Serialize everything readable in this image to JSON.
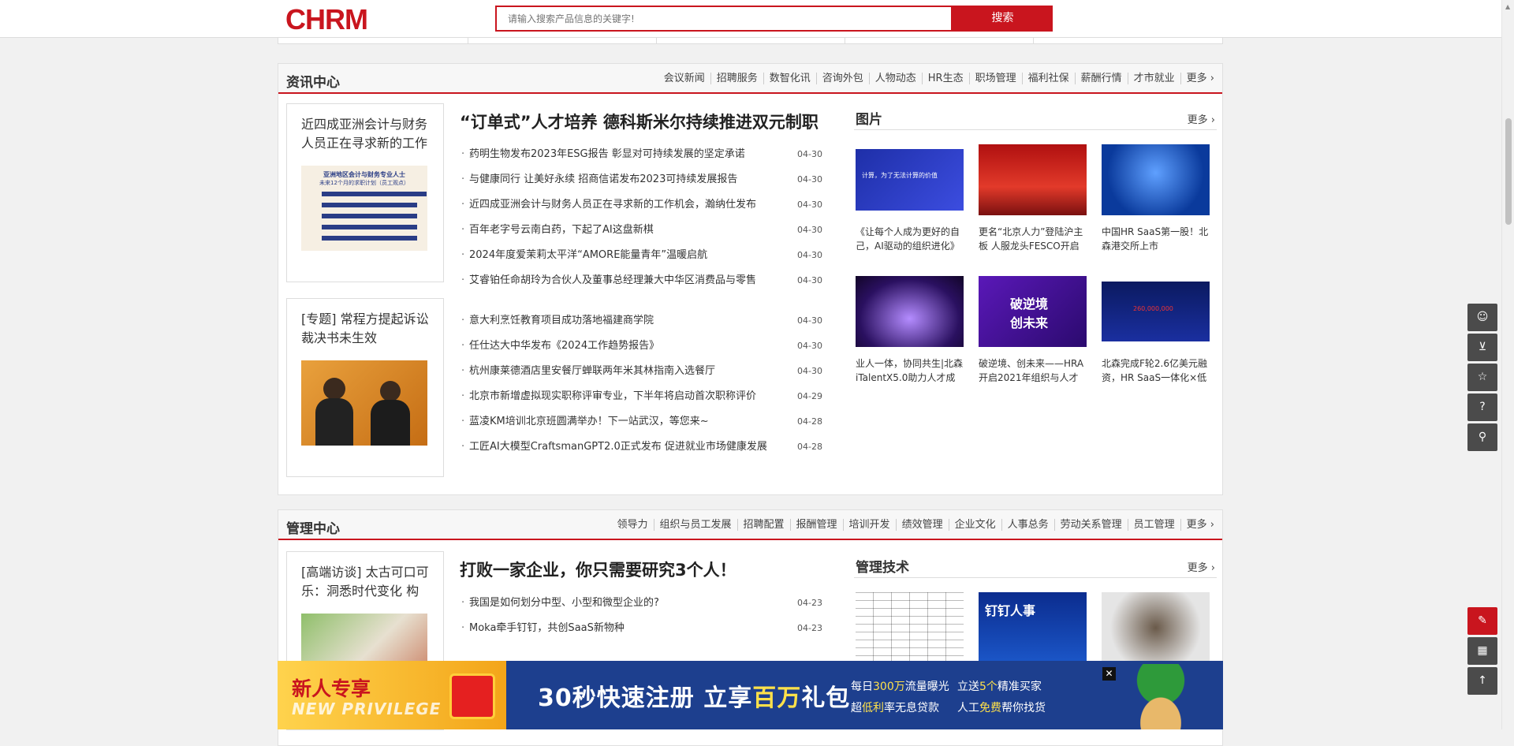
{
  "header": {
    "logo": "CHRM",
    "search_placeholder": "请输入搜索产品信息的关键字!",
    "search_button": "搜索"
  },
  "news_center": {
    "title": "资讯中心",
    "nav": [
      "会议新闻",
      "招聘服务",
      "数智化讯",
      "咨询外包",
      "人物动态",
      "HR生态",
      "职场管理",
      "福利社保",
      "薪酬行情",
      "才市就业",
      "更多"
    ],
    "feature1": {
      "title": "近四成亚洲会计与财务人员正在寻求新的工作",
      "chart_title": "亚洲地区会计与财务专业人士",
      "chart_subtitle": "未来12个月的求职计划（员工观点）"
    },
    "feature2": {
      "title": "[专题] 常程方提起诉讼裁决书未生效"
    },
    "headline": "“订单式”人才培养 德科斯米尔持续推进双元制职",
    "news": [
      {
        "title": "药明生物发布2023年ESG报告 彰显对可持续发展的坚定承诺",
        "date": "04-30"
      },
      {
        "title": "与健康同行 让美好永续 招商信诺发布2023可持续发展报告",
        "date": "04-30"
      },
      {
        "title": "近四成亚洲会计与财务人员正在寻求新的工作机会，瀚纳仕发布",
        "date": "04-30"
      },
      {
        "title": "百年老字号云南白药，下起了AI这盘新棋",
        "date": "04-30"
      },
      {
        "title": "2024年度爱茉莉太平洋“AMORE能量青年”温暖启航",
        "date": "04-30"
      },
      {
        "title": "艾睿铂任命胡玲为合伙人及董事总经理兼大中华区消费品与零售",
        "date": "04-30"
      }
    ],
    "news2": [
      {
        "title": "意大利烹饪教育项目成功落地福建商学院",
        "date": "04-30"
      },
      {
        "title": "任仕达大中华发布《2024工作趋势报告》",
        "date": "04-30"
      },
      {
        "title": "杭州康莱德酒店里安餐厅蝉联两年米其林指南入选餐厅",
        "date": "04-30"
      },
      {
        "title": "北京市新增虚拟现实职称评审专业，下半年将启动首次职称评价",
        "date": "04-29"
      },
      {
        "title": "蓝凌KM培训北京班圆满举办！下一站武汉，等您来~",
        "date": "04-28"
      },
      {
        "title": "工匠AI大模型CraftsmanGPT2.0正式发布 促进就业市场健康发展",
        "date": "04-28"
      }
    ],
    "photos": {
      "title": "图片",
      "more": "更多",
      "items": [
        {
          "caption": "《让每个人成为更好的自己，AI驱动的组织进化》",
          "img_text": "计算，为了无法计算的价值"
        },
        {
          "caption": "更名“北京人力”登陆沪主板 人服龙头FESCO开启",
          "img_text": ""
        },
        {
          "caption": "中国HR SaaS第一股！北森港交所上市",
          "img_text": ""
        },
        {
          "caption": "业人一体，协同共生|北森iTalentX5.0助力人才成功",
          "img_text": ""
        },
        {
          "caption": "破逆境、创未来——HRA开启2021年组织与人才发",
          "img_text": "破逆境 创未来"
        },
        {
          "caption": "北森完成F轮2.6亿美元融资，HR SaaS一体化×低代",
          "img_text": "260,000,000"
        }
      ]
    }
  },
  "mgmt_center": {
    "title": "管理中心",
    "nav": [
      "领导力",
      "组织与员工发展",
      "招聘配置",
      "报酬管理",
      "培训开发",
      "绩效管理",
      "企业文化",
      "人事总务",
      "劳动关系管理",
      "员工管理",
      "更多"
    ],
    "feature1": {
      "title": "[高端访谈] 太古可口可乐：洞悉时代变化 构"
    },
    "headline": "打败一家企业，你只需要研究3个人！",
    "news": [
      {
        "title": "我国是如何划分中型、小型和微型企业的?",
        "date": "04-23"
      },
      {
        "title": "Moka牵手钉钉，共创SaaS新物种",
        "date": "04-23"
      }
    ],
    "tech": {
      "title": "管理技术",
      "more": "更多",
      "img2_text": "钉钉人事"
    }
  },
  "banner": {
    "t1": "新人专享",
    "t2": "NEW PRIVILEGE",
    "main_a": "30秒快速注册 立享",
    "main_b": "百万",
    "main_c": "礼包",
    "s1a": "每日",
    "s1b": "300万",
    "s1c": "流量曝光",
    "s2a": "立送",
    "s2b": "5个",
    "s2c": "精准买家",
    "s3a": "超",
    "s3b": "低利",
    "s3c": "率无息贷款",
    "s4a": "人工",
    "s4b": "免费",
    "s4c": "帮你找货",
    "close": "✕"
  },
  "side_icons": [
    "user-icon",
    "cart-icon",
    "star-icon",
    "help-icon",
    "location-icon",
    "edit-icon",
    "qrcode-icon"
  ]
}
